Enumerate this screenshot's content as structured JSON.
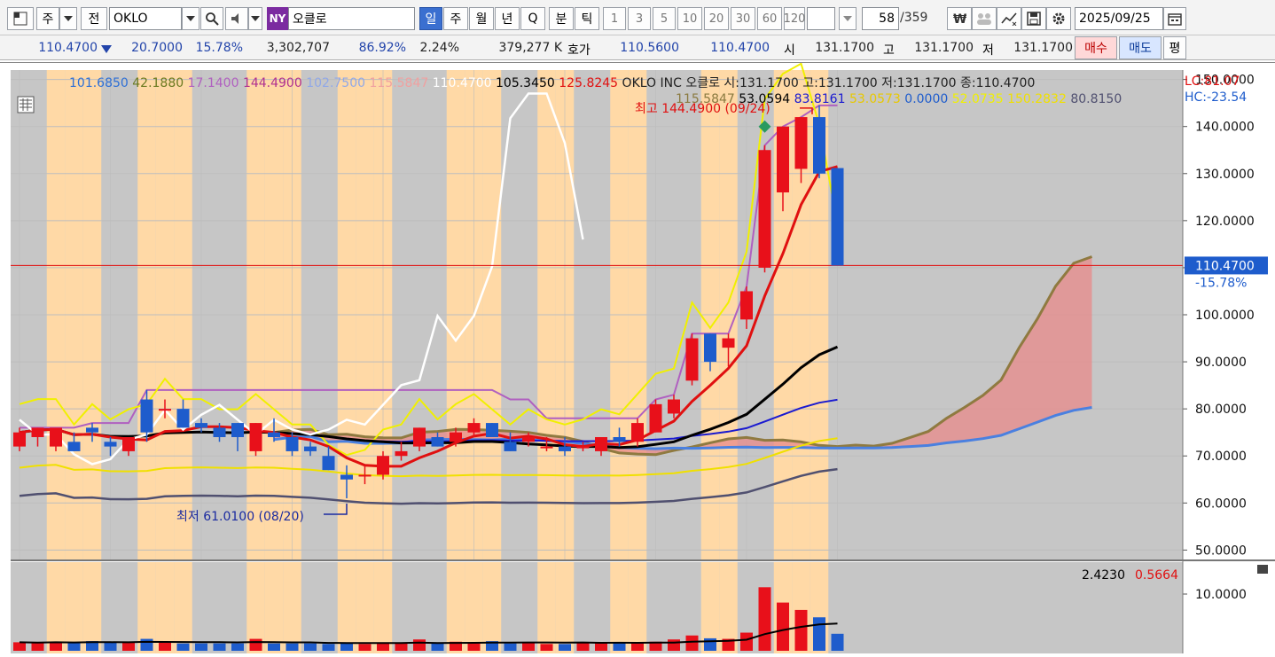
{
  "toolbar": {
    "tab_stock": "주",
    "tab_prev": "전",
    "symbol": "OKLO",
    "exchange_badge": "NY",
    "name": "오클로",
    "periods": [
      "일",
      "주",
      "월",
      "년",
      "Q",
      "분",
      "틱"
    ],
    "ticks": [
      "1",
      "3",
      "5",
      "10",
      "20",
      "30",
      "60",
      "120"
    ],
    "count": "58",
    "total": "/359",
    "date": "2025/09/25"
  },
  "quote": {
    "price": "110.4700",
    "change": "20.7000",
    "change_pct": "15.78%",
    "volume": "3,302,707",
    "vol_ratio": "86.92%",
    "turnover": "2.24%",
    "amount": "379,277 K",
    "bid_label": "호가",
    "bid": "110.5600",
    "ask": "110.4700",
    "open_label": "시",
    "open": "131.1700",
    "high_label": "고",
    "high": "131.1700",
    "low_label": "저",
    "low": "131.1700",
    "buy": "매수",
    "sell": "매도",
    "eval": "평"
  },
  "colors": {
    "up": "#e8101a",
    "down": "#1e5ccc",
    "band": "#ffd9a6",
    "grid": "#bdbdbd",
    "bg": "#c6c6c6"
  },
  "legend1": [
    {
      "t": "101.6850",
      "c": "#2d6fd6"
    },
    {
      "t": "42.1880",
      "c": "#6b7a20"
    },
    {
      "t": "17.1400",
      "c": "#b060c0"
    },
    {
      "t": "144.4900",
      "c": "#b03090"
    },
    {
      "t": "102.7500",
      "c": "#90a8e8"
    },
    {
      "t": "115.5847",
      "c": "#f0a0a0"
    },
    {
      "t": "110.4700",
      "c": "#ffffff"
    },
    {
      "t": "105.3450",
      "c": "#000000"
    },
    {
      "t": "125.8245",
      "c": "#e01010"
    },
    {
      "t": "OKLO INC  오클로 시:131.1700 고:131.1700 저:131.1700 종:110.4700",
      "c": "#222222"
    }
  ],
  "legend2": [
    {
      "t": "115.5847",
      "c": "#8a7a40"
    },
    {
      "t": "53.0594",
      "c": "#000000"
    },
    {
      "t": "83.8161",
      "c": "#1a1ad0"
    },
    {
      "t": "53.0573",
      "c": "#e8c800"
    },
    {
      "t": "0.0000",
      "c": "#1e5ccc"
    },
    {
      "t": "52.0735",
      "c": "#f0f000"
    },
    {
      "t": "150.2832",
      "c": "#f0e000"
    },
    {
      "t": "80.8150",
      "c": "#505070"
    }
  ],
  "lc": "LC:81.07",
  "hc": "HC:-23.54",
  "annot_high": "최고 144.4900 (09/24)",
  "annot_low": "최저 61.0100 (08/20)",
  "price_label": "110.4700",
  "pct_label": "-15.78%",
  "vol_legend": {
    "a": "2.4230",
    "b": "0.5664"
  },
  "chart_data": {
    "type": "candlestick",
    "ylim": [
      48,
      152
    ],
    "yticks": [
      "150.0000",
      "140.0000",
      "130.0000",
      "120.0000",
      "110.0000",
      "100.0000",
      "90.0000",
      "80.0000",
      "70.0000",
      "60.0000",
      "50.0000"
    ],
    "vol_tick": "10.0000",
    "candles": [
      {
        "o": 72,
        "h": 76,
        "l": 71,
        "c": 75
      },
      {
        "o": 74,
        "h": 76,
        "l": 72,
        "c": 76
      },
      {
        "o": 72,
        "h": 75,
        "l": 71,
        "c": 76
      },
      {
        "o": 73,
        "h": 75,
        "l": 71,
        "c": 71
      },
      {
        "o": 76,
        "h": 77,
        "l": 73,
        "c": 75
      },
      {
        "o": 73,
        "h": 74,
        "l": 70,
        "c": 72
      },
      {
        "o": 71,
        "h": 74,
        "l": 70,
        "c": 74
      },
      {
        "o": 82,
        "h": 84,
        "l": 73,
        "c": 75
      },
      {
        "o": 80,
        "h": 82,
        "l": 78,
        "c": 80
      },
      {
        "o": 80,
        "h": 82,
        "l": 76,
        "c": 76
      },
      {
        "o": 77,
        "h": 78,
        "l": 75,
        "c": 76
      },
      {
        "o": 76,
        "h": 77,
        "l": 73,
        "c": 74
      },
      {
        "o": 77,
        "h": 77,
        "l": 71,
        "c": 74
      },
      {
        "o": 71,
        "h": 77,
        "l": 70,
        "c": 77
      },
      {
        "o": 75,
        "h": 78,
        "l": 73,
        "c": 74
      },
      {
        "o": 74,
        "h": 75,
        "l": 70,
        "c": 71
      },
      {
        "o": 72,
        "h": 73,
        "l": 70,
        "c": 71
      },
      {
        "o": 70,
        "h": 72,
        "l": 67,
        "c": 67
      },
      {
        "o": 66,
        "h": 68,
        "l": 61,
        "c": 65
      },
      {
        "o": 66,
        "h": 68,
        "l": 64,
        "c": 66
      },
      {
        "o": 66,
        "h": 71,
        "l": 65,
        "c": 70
      },
      {
        "o": 70,
        "h": 73,
        "l": 69,
        "c": 71
      },
      {
        "o": 72,
        "h": 76,
        "l": 71,
        "c": 76
      },
      {
        "o": 74,
        "h": 75,
        "l": 72,
        "c": 72
      },
      {
        "o": 73,
        "h": 76,
        "l": 72,
        "c": 75
      },
      {
        "o": 75,
        "h": 78,
        "l": 74,
        "c": 77
      },
      {
        "o": 77,
        "h": 77,
        "l": 74,
        "c": 74
      },
      {
        "o": 73,
        "h": 75,
        "l": 71,
        "c": 71
      },
      {
        "o": 73,
        "h": 75,
        "l": 72,
        "c": 74
      },
      {
        "o": 72,
        "h": 74,
        "l": 71,
        "c": 72
      },
      {
        "o": 72,
        "h": 74,
        "l": 70,
        "c": 71
      },
      {
        "o": 72,
        "h": 73,
        "l": 71,
        "c": 72
      },
      {
        "o": 71,
        "h": 74,
        "l": 70,
        "c": 74
      },
      {
        "o": 74,
        "h": 76,
        "l": 72,
        "c": 73
      },
      {
        "o": 73,
        "h": 78,
        "l": 72,
        "c": 77
      },
      {
        "o": 75,
        "h": 82,
        "l": 75,
        "c": 81
      },
      {
        "o": 79,
        "h": 83,
        "l": 78,
        "c": 82
      },
      {
        "o": 86,
        "h": 96,
        "l": 85,
        "c": 95
      },
      {
        "o": 96,
        "h": 96,
        "l": 88,
        "c": 90
      },
      {
        "o": 93,
        "h": 96,
        "l": 89,
        "c": 95
      },
      {
        "o": 99,
        "h": 106,
        "l": 97,
        "c": 105
      },
      {
        "o": 110,
        "h": 136,
        "l": 109,
        "c": 135
      },
      {
        "o": 126,
        "h": 140,
        "l": 122,
        "c": 140
      },
      {
        "o": 131,
        "h": 142,
        "l": 128,
        "c": 142
      },
      {
        "o": 142,
        "h": 144.49,
        "l": 129,
        "c": 130
      },
      {
        "o": 131.17,
        "h": 131.17,
        "l": 110.47,
        "c": 110.47
      }
    ],
    "volumes": [
      1.5,
      1.4,
      1.6,
      1.4,
      1.7,
      1.5,
      1.4,
      2.1,
      1.5,
      1.3,
      1.3,
      1.3,
      1.3,
      2.1,
      1.3,
      1.3,
      1.3,
      1.2,
      1.3,
      1.2,
      1.3,
      1.3,
      2.0,
      1.4,
      1.6,
      1.4,
      1.7,
      1.3,
      1.5,
      1.2,
      1.2,
      1.4,
      1.4,
      1.5,
      1.5,
      1.6,
      2.0,
      2.7,
      2.2,
      2.1,
      3.2,
      11.2,
      8.5,
      7.2,
      5.9,
      3.0
    ]
  }
}
